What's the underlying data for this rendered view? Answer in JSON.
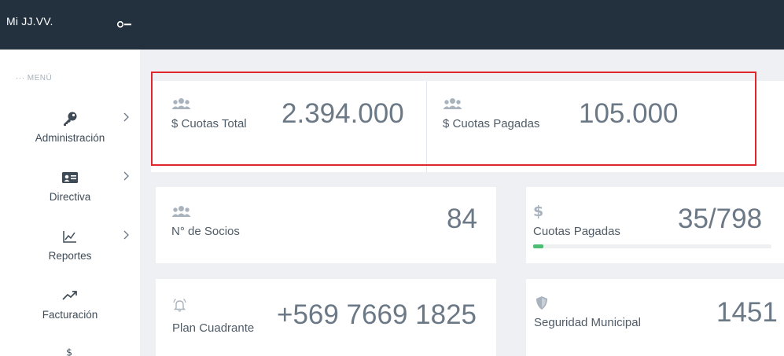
{
  "app": {
    "title": "Mi JJ.VV."
  },
  "sidebar": {
    "menu_label": "··· MENÚ",
    "items": [
      {
        "label": "Administración",
        "icon": "key-icon",
        "has_submenu": true
      },
      {
        "label": "Directiva",
        "icon": "id-card-icon",
        "has_submenu": true
      },
      {
        "label": "Reportes",
        "icon": "line-chart-icon",
        "has_submenu": true
      },
      {
        "label": "Facturación",
        "icon": "trending-up-icon",
        "has_submenu": false
      },
      {
        "label": "",
        "icon": "dollar-icon",
        "has_submenu": false
      }
    ]
  },
  "stats": {
    "cuotas_total": {
      "label": "$ Cuotas Total",
      "value": "2.394.000",
      "icon": "users-icon"
    },
    "cuotas_pagadas_monto": {
      "label": "$ Cuotas Pagadas",
      "value": "105.000",
      "icon": "users-icon"
    },
    "socios": {
      "label": "N° de Socios",
      "value": "84",
      "icon": "users-icon"
    },
    "cuotas_pagadas": {
      "label": "Cuotas Pagadas",
      "value": "35/798",
      "icon": "dollar-icon",
      "progress_fraction": 0.044
    },
    "plan_cuadrante": {
      "label": "Plan Cuadrante",
      "value": "+569 7669 1825",
      "icon": "bell-icon"
    },
    "seguridad": {
      "label": "Seguridad Municipal",
      "value": "1451",
      "icon": "shield-icon"
    }
  },
  "colors": {
    "topbar": "#23313f",
    "highlight_border": "#e1252c",
    "progress": "#4dbd74",
    "icon_gray": "#a9b3bd"
  }
}
